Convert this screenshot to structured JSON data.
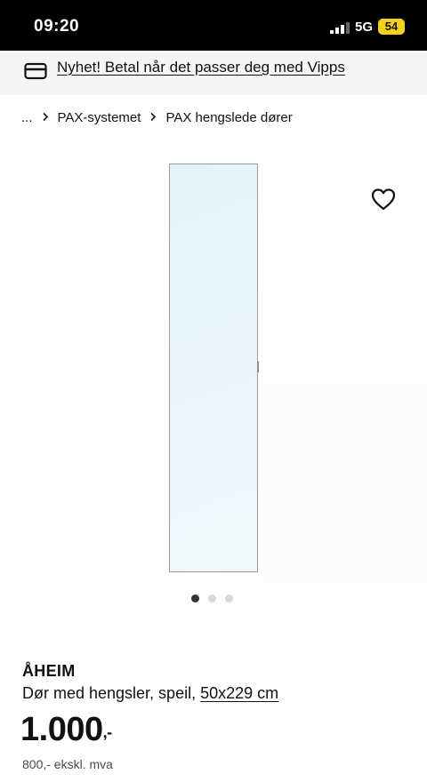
{
  "status_bar": {
    "time": "09:20",
    "network": "5G",
    "battery": "54"
  },
  "promo": {
    "text": "Nyhet! Betal når det passer deg med Vipps",
    "icon": "card-icon"
  },
  "breadcrumb": {
    "ellipsis": "...",
    "items": [
      "PAX-systemet",
      "PAX hengslede dører"
    ],
    "separator_icon": "chevron-right-icon"
  },
  "product": {
    "name": "ÅHEIM",
    "description": "Dør med hengsler, speil,",
    "size": "50x229 cm",
    "price": "1.000",
    "price_suffix": ",-",
    "price_ex_vat": "800,- ekskl. mva"
  },
  "carousel": {
    "total": 3,
    "active_index": 0
  },
  "colors": {
    "status_bar_bg": "#000000",
    "battery_badge": "#f4d21a",
    "promo_bg": "#f5f5f5",
    "mirror_tint": "#e6f4f7"
  }
}
